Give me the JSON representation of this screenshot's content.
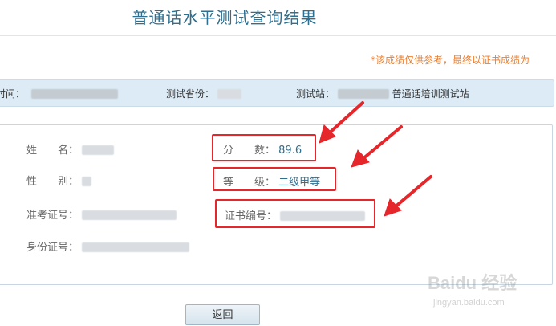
{
  "page": {
    "title": "普通话水平测试查询结果",
    "notice": "*该成绩仅供参考，最终以证书成绩为"
  },
  "info_bar": {
    "time_label": "时间：",
    "province_label": "测试省份：",
    "station_label": "测试站：",
    "station_name": "普通话培训测试站"
  },
  "result": {
    "name_label": "姓　　名：",
    "gender_label": "性　　别：",
    "exam_id_label": "准考证号：",
    "id_card_label": "身份证号：",
    "score_label": "分　　数：",
    "score_value": "89.6",
    "grade_label": "等　　级：",
    "grade_value": "二级甲等",
    "cert_label": "证书编号："
  },
  "actions": {
    "back_label": "返回"
  },
  "watermark": {
    "logo": "Baidu 经验",
    "url": "jingyan.baidu.com"
  },
  "colors": {
    "title": "#2f6f8f",
    "notice": "#f07d2a",
    "info_bar_bg": "#dcebf5",
    "highlight": "#e5262b"
  }
}
